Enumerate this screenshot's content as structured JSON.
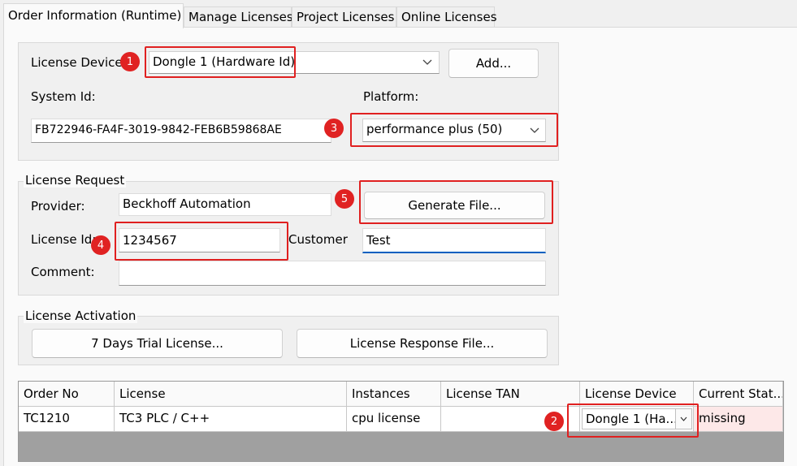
{
  "tabs": [
    {
      "label": "Order Information (Runtime)"
    },
    {
      "label": "Manage Licenses"
    },
    {
      "label": "Project Licenses"
    },
    {
      "label": "Online Licenses"
    }
  ],
  "device": {
    "license_device_label": "License Device",
    "license_device_value": "Dongle 1 (Hardware Id)",
    "add_button": "Add...",
    "system_id_label": "System Id:",
    "system_id_value": "FB722946-FA4F-3019-9842-FEB6B59868AE",
    "platform_label": "Platform:",
    "platform_value": "performance plus (50)"
  },
  "request": {
    "title": "License Request",
    "provider_label": "Provider:",
    "provider_value": "Beckhoff Automation",
    "generate_button": "Generate File...",
    "license_id_label": "License Id:",
    "license_id_value": "1234567",
    "customer_label": "Customer",
    "customer_value": "Test",
    "comment_label": "Comment:",
    "comment_value": ""
  },
  "activation": {
    "title": "License Activation",
    "trial_button": "7 Days Trial License...",
    "response_button": "License Response File..."
  },
  "table": {
    "headers": [
      "Order No",
      "License",
      "Instances",
      "License TAN",
      "License Device",
      "Current Stat..."
    ],
    "rows": [
      [
        "TC1210",
        "TC3 PLC / C++",
        "cpu license",
        "",
        "Dongle 1 (Ha...",
        "missing"
      ]
    ]
  },
  "badges": [
    "1",
    "2",
    "3",
    "4",
    "5"
  ],
  "colors": {
    "highlight": "#e02020",
    "badge": "#e02222",
    "missing_bg": "#fde8e8",
    "focus_underline": "#0060c0"
  }
}
